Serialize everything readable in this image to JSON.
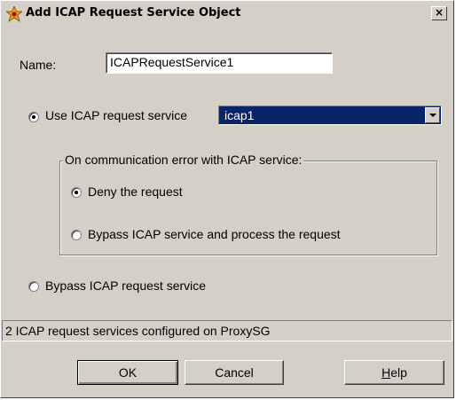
{
  "window": {
    "title": "Add ICAP Request Service Object",
    "close_glyph": "×"
  },
  "name": {
    "label": "Name:",
    "value": "ICAPRequestService1"
  },
  "use_icap": {
    "label": "Use ICAP request service",
    "checked": true,
    "select_value": "icap1"
  },
  "group": {
    "title": "On communication error with ICAP service:",
    "deny_label": "Deny the request",
    "deny_checked": true,
    "bypass_label": "Bypass ICAP service and process the request",
    "bypass_checked": false
  },
  "bypass_request": {
    "label": "Bypass ICAP request service",
    "checked": false
  },
  "status": "2 ICAP request services configured on ProxySG",
  "buttons": {
    "ok": "OK",
    "cancel": "Cancel",
    "help_mnemonic": "H",
    "help_rest": "elp"
  }
}
